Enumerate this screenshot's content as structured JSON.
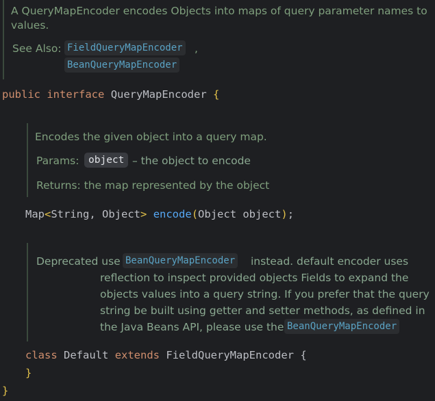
{
  "top_doc": {
    "line1": "A QueryMapEncoder encodes Objects into maps of query parameter names to",
    "line2": "values.",
    "see_also_label": "See Also:",
    "see_also_link1": "FieldQueryMapEncoder",
    "see_also_sep": ",",
    "see_also_link2": "BeanQueryMapEncoder"
  },
  "interface_decl": {
    "kw1": "public",
    "kw2": "interface",
    "name": "QueryMapEncoder",
    "brace": "{"
  },
  "method_doc": {
    "summary": "Encodes the given object into a query map.",
    "params_label": "Params:",
    "param_name": "object",
    "param_desc": "– the object to encode",
    "returns": "Returns: the map represented by the object"
  },
  "method_decl": {
    "ret_type_a": "Map",
    "lt": "<",
    "ret_type_b": "String, Object",
    "gt": ">",
    "fn_name": "encode",
    "lparen": "(",
    "args": "Object object",
    "rparen": ")",
    "semi": ";"
  },
  "deprecated_doc": {
    "prefix": "Deprecated use",
    "link1": "BeanQueryMapEncoder",
    "after_link1": "instead. default encoder uses",
    "line2": "reflection to inspect provided objects Fields to expand the",
    "line3": "objects values into a query string. If you prefer that the query",
    "line4": "string be built using getter and setter methods, as defined in",
    "line5_prefix": "the Java Beans API, please use the",
    "link2": "BeanQueryMapEncoder"
  },
  "class_decl": {
    "kw1": "class",
    "name": "Default",
    "kw2": "extends",
    "parent": "FieldQueryMapEncoder",
    "brace_open": "{",
    "brace_close": "}"
  },
  "interface_close": "}",
  "colors": {
    "background": "#1e1f22",
    "keyword": "#cf8e6d",
    "function": "#56a8f5",
    "doc_text": "#7f9f7d",
    "link": "#5aa3c5"
  }
}
